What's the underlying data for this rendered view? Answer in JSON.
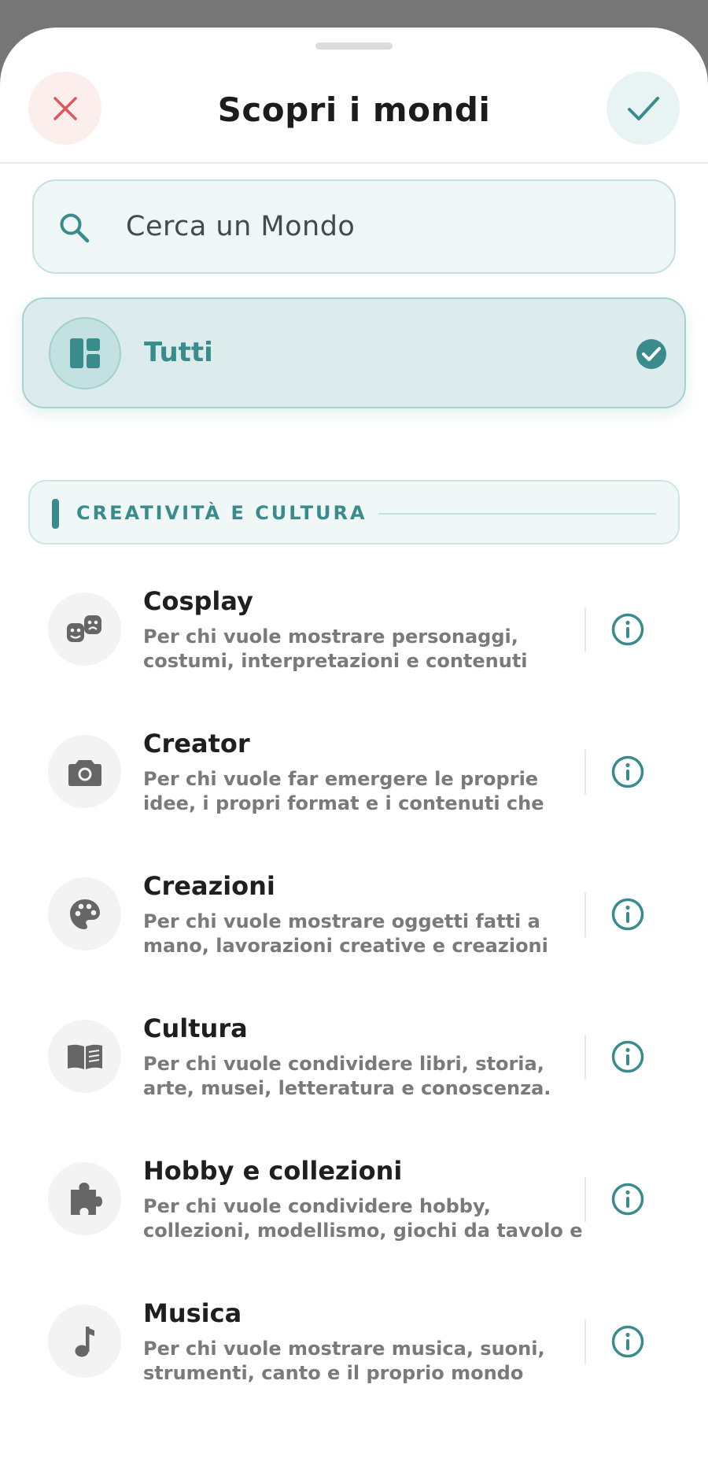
{
  "header": {
    "title": "Scopri i mondi"
  },
  "search": {
    "placeholder": "Cerca un Mondo"
  },
  "all": {
    "label": "Tutti"
  },
  "section": {
    "label": "CREATIVITÀ E CULTURA"
  },
  "items": [
    {
      "title": "Cosplay",
      "desc": "Per chi vuole mostrare personaggi,\ncostumi, interpretazioni e contenuti",
      "icon": "masks-icon"
    },
    {
      "title": "Creator",
      "desc": "Per chi vuole far emergere le proprie\nidee, i propri format e i contenuti che",
      "icon": "camera-icon"
    },
    {
      "title": "Creazioni",
      "desc": "Per chi vuole mostrare oggetti fatti a\nmano, lavorazioni creative e creazioni",
      "icon": "palette-icon"
    },
    {
      "title": "Cultura",
      "desc": "Per chi vuole condividere libri, storia,\narte, musei, letteratura e conoscenza.",
      "icon": "book-icon"
    },
    {
      "title": "Hobby e collezioni",
      "desc": "Per chi vuole condividere hobby,\ncollezioni, modellismo, giochi da tavolo e",
      "icon": "puzzle-icon"
    },
    {
      "title": "Musica",
      "desc": "Per chi vuole mostrare musica, suoni,\nstrumenti, canto e il proprio mondo",
      "icon": "music-note-icon"
    }
  ],
  "colors": {
    "accent": "#3a8c8c",
    "close": "#e0565b",
    "icon_gray": "#666666"
  }
}
